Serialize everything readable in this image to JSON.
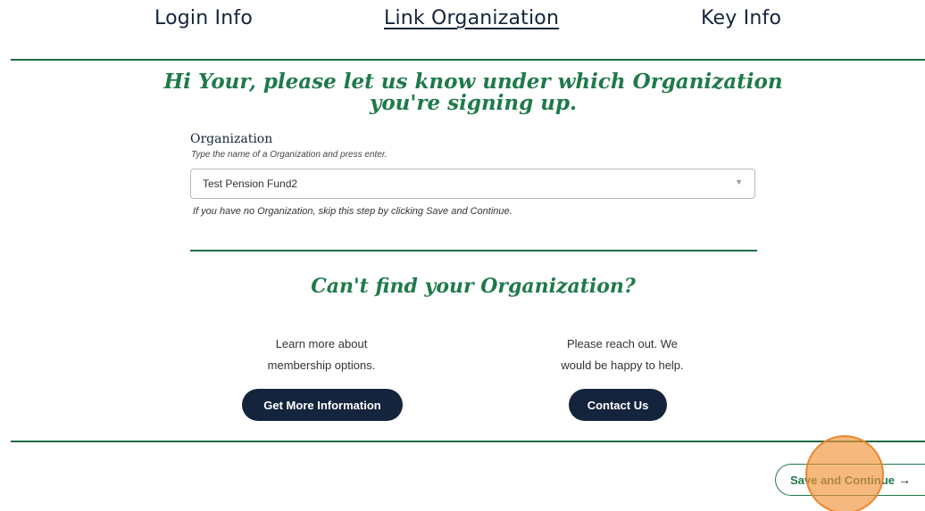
{
  "steps": {
    "login_info": "Login Info",
    "link_organization": "Link Organization",
    "key_info": "Key Info"
  },
  "headline": {
    "line1": "Hi Your, please let us know under which Organization",
    "line2": "you're signing up."
  },
  "organization": {
    "label": "Organization",
    "hint": "Type the name of a Organization and press enter.",
    "selected_value": "Test Pension Fund2",
    "caret": "▼",
    "skip_note": "If you have no Organization, skip this step by clicking Save and Continue."
  },
  "cant_find": {
    "heading": "Can't find your Organization?",
    "left_line1": "Learn more about",
    "left_line2": "membership options.",
    "right_line1": "Please reach out. We",
    "right_line2": "would be happy to help.",
    "more_info_button": "Get More Information",
    "contact_button": "Contact Us"
  },
  "footer": {
    "save_button": "Save and Continue",
    "save_arrow": "→"
  },
  "colors": {
    "accent_green": "#1f7a4a",
    "navy": "#15243d",
    "click_highlight": "#f39237"
  }
}
